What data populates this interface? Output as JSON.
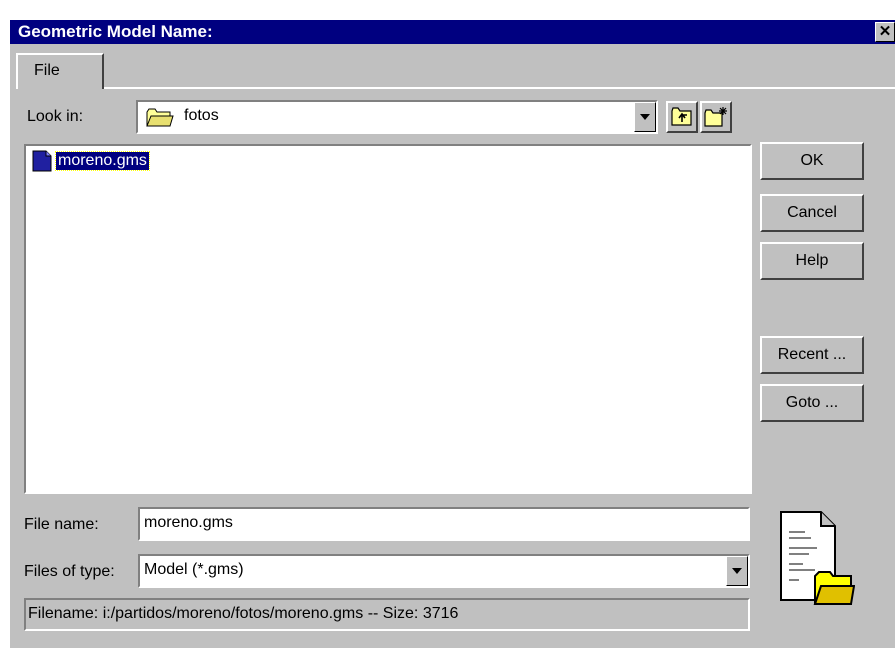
{
  "window": {
    "title": "Geometric Model Name:",
    "close_glyph": "✕"
  },
  "tabs": [
    {
      "label": "File"
    }
  ],
  "look_in": {
    "label": "Look in:",
    "value": "fotos",
    "icon": "folder-icon"
  },
  "toolbar": {
    "up_folder_icon": "up-folder-icon",
    "new_folder_icon": "new-folder-icon"
  },
  "files": [
    {
      "name": "moreno.gms",
      "icon": "document-icon",
      "selected": true
    }
  ],
  "buttons": {
    "ok": "OK",
    "cancel": "Cancel",
    "help": "Help",
    "recent": "Recent ...",
    "goto": "Goto ..."
  },
  "file_name": {
    "label": "File name:",
    "value": "moreno.gms"
  },
  "files_of_type": {
    "label": "Files of type:",
    "value": "Model (*.gms)"
  },
  "status": {
    "text": "Filename: i:/partidos/moreno/fotos/moreno.gms -- Size: 3716"
  },
  "decor": {
    "preview_icon": "document-folder-icon"
  }
}
